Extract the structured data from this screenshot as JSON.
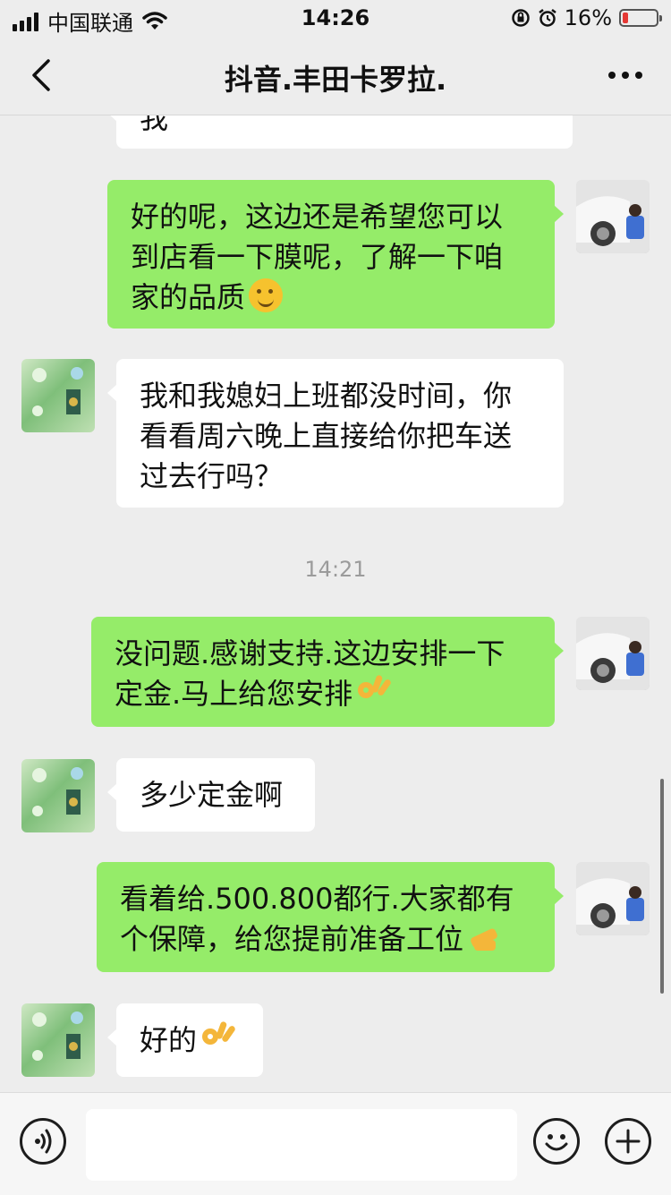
{
  "status_bar": {
    "carrier": "中国联通",
    "time": "14:26",
    "battery": "16%"
  },
  "nav": {
    "title": "抖音.丰田卡罗拉."
  },
  "messages": [
    {
      "side": "in",
      "lines": [
        "我"
      ]
    },
    {
      "side": "out",
      "lines": [
        "好的呢，这边还是希望您可以",
        "到店看一下膜呢，了解一下咱",
        "家的品质"
      ],
      "emoji": "smirk-emoji"
    },
    {
      "side": "in",
      "lines": [
        "我和我媳妇上班都没时间，你",
        "看看周六晚上直接给你把车送",
        "过去行吗？"
      ]
    },
    {
      "time": "14:21"
    },
    {
      "side": "out",
      "lines": [
        "没问题.感谢支持.这边安排一下",
        "定金.马上给您安排"
      ],
      "emoji": "ok-hand-emoji"
    },
    {
      "side": "in",
      "lines": [
        "多少定金啊"
      ]
    },
    {
      "side": "out",
      "lines": [
        "看着给.500.800都行.大家都有",
        "个保障，给您提前准备工位"
      ],
      "emoji": "pointing-hand-emoji"
    },
    {
      "side": "in",
      "lines": [
        "好的"
      ],
      "emoji": "ok-hand-emoji"
    }
  ],
  "colors": {
    "outgoing_bubble": "#95ec69",
    "incoming_bubble": "#ffffff",
    "background": "#ededed"
  }
}
